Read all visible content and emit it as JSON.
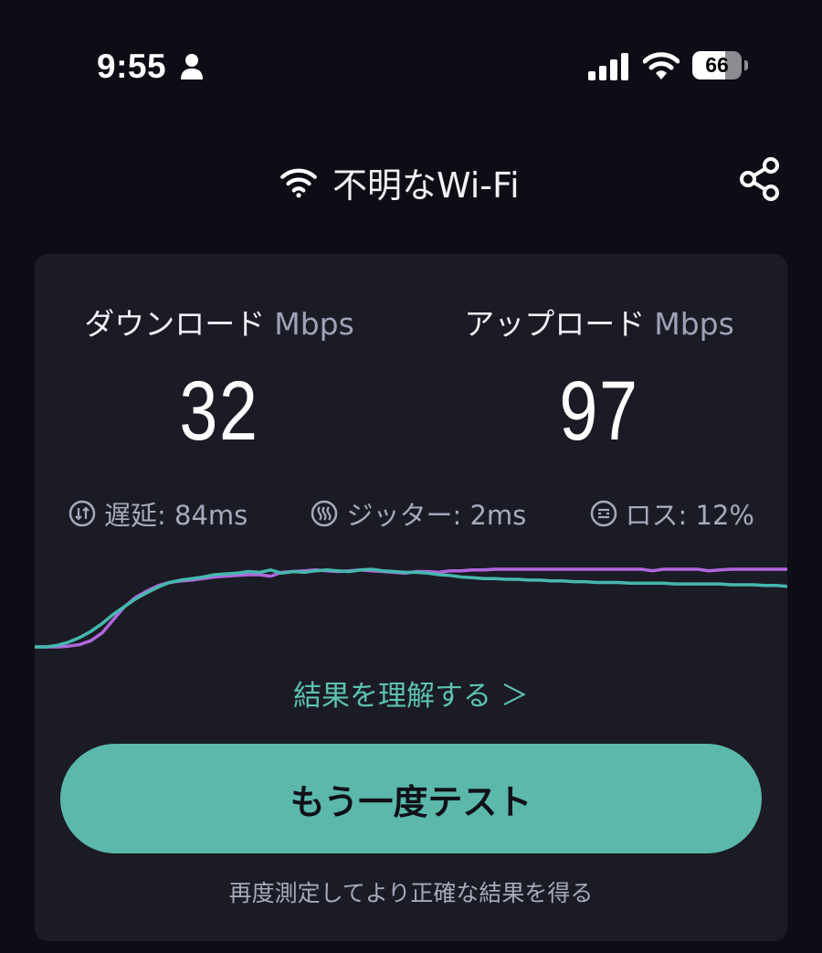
{
  "status_bar": {
    "time": "9:55",
    "battery": "66",
    "battery_level": 0.66,
    "icons": [
      "person-icon",
      "cellular-signal-icon",
      "wifi-icon",
      "battery-icon"
    ]
  },
  "header": {
    "network_name": "不明なWi-Fi",
    "network_icon": "wifi-icon",
    "share_icon": "share-icon"
  },
  "results": {
    "download": {
      "label": "ダウンロード",
      "unit": "Mbps",
      "value": "32"
    },
    "upload": {
      "label": "アップロード",
      "unit": "Mbps",
      "value": "97"
    },
    "stats": {
      "latency": "遅延: 84ms",
      "jitter": "ジッター: 2ms",
      "loss": "ロス: 12%"
    }
  },
  "graph": {
    "colors": {
      "download": "#46b8ae",
      "upload": "#b067dd"
    },
    "download_curve": [
      0.0,
      0.0,
      0.02,
      0.06,
      0.12,
      0.2,
      0.3,
      0.42,
      0.52,
      0.62,
      0.7,
      0.77,
      0.83,
      0.86,
      0.88,
      0.9,
      0.93,
      0.94,
      0.95,
      0.97,
      0.96,
      0.99,
      0.95,
      0.97,
      0.96,
      0.98,
      0.99,
      0.98,
      0.97,
      0.99,
      1.0,
      0.98,
      0.97,
      0.96,
      0.96,
      0.95,
      0.93,
      0.92,
      0.9,
      0.89,
      0.88,
      0.88,
      0.87,
      0.87,
      0.86,
      0.86,
      0.85,
      0.85,
      0.84,
      0.84,
      0.83,
      0.83,
      0.83,
      0.82,
      0.82,
      0.82,
      0.82,
      0.81,
      0.81,
      0.81,
      0.81,
      0.81,
      0.8,
      0.8,
      0.8,
      0.79,
      0.79,
      0.78
    ],
    "upload_curve": [
      0.0,
      0.0,
      0.0,
      0.01,
      0.03,
      0.08,
      0.18,
      0.35,
      0.52,
      0.64,
      0.72,
      0.79,
      0.83,
      0.85,
      0.86,
      0.88,
      0.9,
      0.91,
      0.92,
      0.93,
      0.93,
      0.91,
      0.96,
      0.97,
      0.98,
      0.99,
      0.98,
      0.97,
      0.98,
      0.99,
      0.98,
      0.97,
      0.96,
      0.95,
      0.97,
      0.97,
      0.96,
      0.98,
      0.98,
      0.99,
      0.99,
      1.0,
      1.0,
      1.0,
      1.0,
      1.0,
      1.0,
      1.0,
      1.0,
      1.0,
      1.0,
      1.0,
      1.0,
      1.0,
      1.0,
      0.98,
      1.0,
      1.0,
      1.0,
      1.0,
      0.98,
      0.99,
      1.0,
      1.0,
      1.0,
      1.0,
      1.0,
      1.0
    ]
  },
  "actions": {
    "understand": "結果を理解する ＞",
    "retest": "もう一度テスト",
    "hint": "再度測定してより正確な結果を得る"
  }
}
